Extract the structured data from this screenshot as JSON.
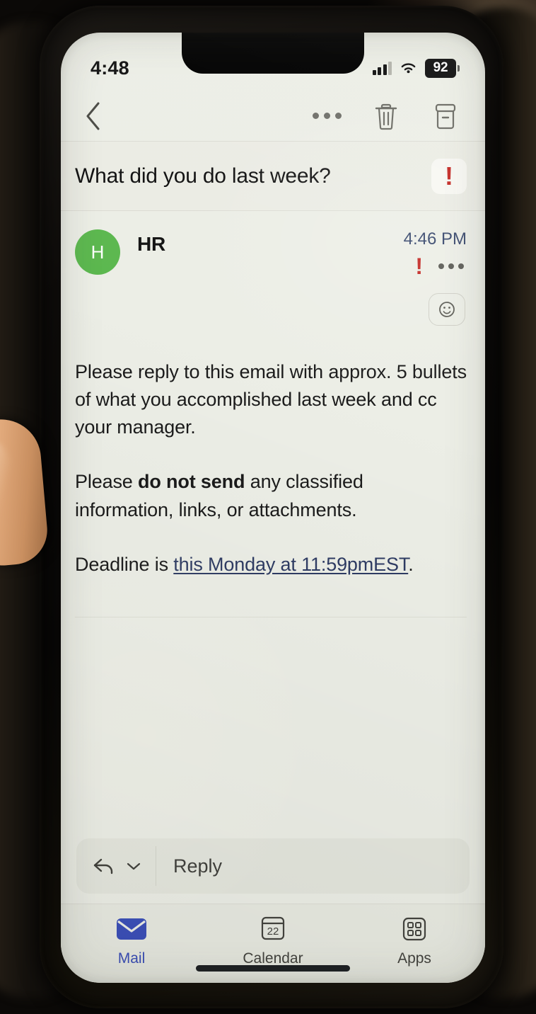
{
  "status_bar": {
    "time": "4:48",
    "battery_level": "92",
    "signal_icon": "cellular-signal-icon",
    "wifi_icon": "wifi-icon",
    "battery_icon": "battery-icon"
  },
  "nav_bar": {
    "back_icon": "chevron-left-icon",
    "more_icon": "more-options-icon",
    "delete_icon": "trash-icon",
    "archive_icon": "archive-icon"
  },
  "subject": {
    "text": "What did you do last week?",
    "importance_icon": "high-importance-exclamation-icon"
  },
  "message": {
    "avatar_initial": "H",
    "avatar_color": "#5cb84f",
    "sender": "HR",
    "time": "4:46 PM",
    "importance_icon": "high-importance-exclamation-icon",
    "more_icon": "more-options-icon",
    "react_icon": "smiley-reaction-icon",
    "body": {
      "paragraph_1": "Please reply to this email with approx. 5 bullets of what you accomplished last week and cc your manager.",
      "paragraph_2_prefix": "Please ",
      "paragraph_2_bold": "do not send",
      "paragraph_2_suffix": " any classified information, links, or attachments.",
      "paragraph_3_prefix": "Deadline is ",
      "paragraph_3_link": "this Monday at 11:59pmEST",
      "paragraph_3_suffix": "."
    }
  },
  "reply_bar": {
    "reply_icon": "reply-arrow-icon",
    "chevron_icon": "chevron-down-icon",
    "placeholder": "Reply"
  },
  "tab_bar": {
    "active_color": "#3b4fb8",
    "tabs": [
      {
        "label": "Mail",
        "icon": "mail-envelope-icon",
        "active": true
      },
      {
        "label": "Calendar",
        "icon": "calendar-icon",
        "calendar_day": "22",
        "active": false
      },
      {
        "label": "Apps",
        "icon": "apps-grid-icon",
        "active": false
      }
    ]
  }
}
